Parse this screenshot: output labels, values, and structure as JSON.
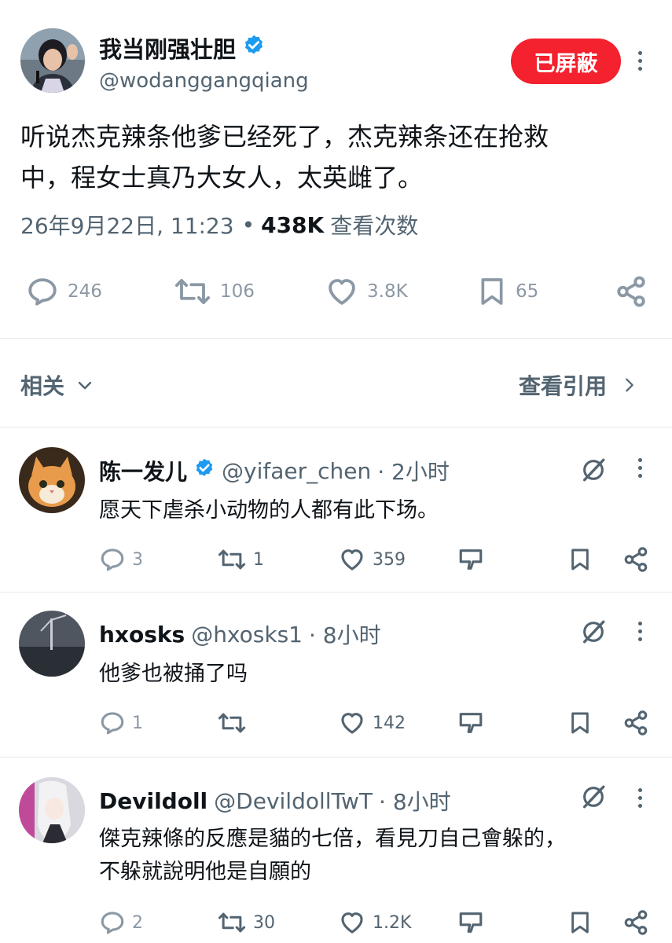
{
  "main_tweet": {
    "display_name": "我当刚强壮胆",
    "handle": "@wodanggangqiang",
    "blocked_label": "已屏蔽",
    "text_line1": "听说杰克辣条他爹已经死了，杰克辣条还在抢救",
    "text_line2": "中，程女士真乃大女人，太英雌了。",
    "timestamp": "26年9月22日, 11:23",
    "separator": "•",
    "views_count": "438K",
    "views_label": "查看次数",
    "replies": "246",
    "retweets": "106",
    "likes": "3.8K",
    "bookmarks": "65",
    "verified_color": "#1d9bf0",
    "blocked_color": "#f4212e"
  },
  "section": {
    "related_label": "相关",
    "quotes_label": "查看引用"
  },
  "replies": [
    {
      "display_name": "陈一发儿",
      "verified": true,
      "handle": "@yifaer_chen",
      "time": "· 2小时",
      "text_line1": "愿天下虐杀小动物的人都有此下场。",
      "text_line2": "",
      "replies": "3",
      "retweets": "1",
      "likes": "359"
    },
    {
      "display_name": "hxosks",
      "verified": false,
      "handle": "@hxosks1",
      "time": "· 8小时",
      "text_line1": "他爹也被捅了吗",
      "text_line2": "",
      "replies": "1",
      "retweets": "",
      "likes": "142"
    },
    {
      "display_name": "Devildoll",
      "verified": false,
      "handle": "@DevildollTwT",
      "time": "· 8小时",
      "text_line1": "傑克辣條的反應是貓的七倍，看見刀自己會躲的，",
      "text_line2": "不躲就說明他是自願的",
      "replies": "2",
      "retweets": "30",
      "likes": "1.2K"
    }
  ]
}
